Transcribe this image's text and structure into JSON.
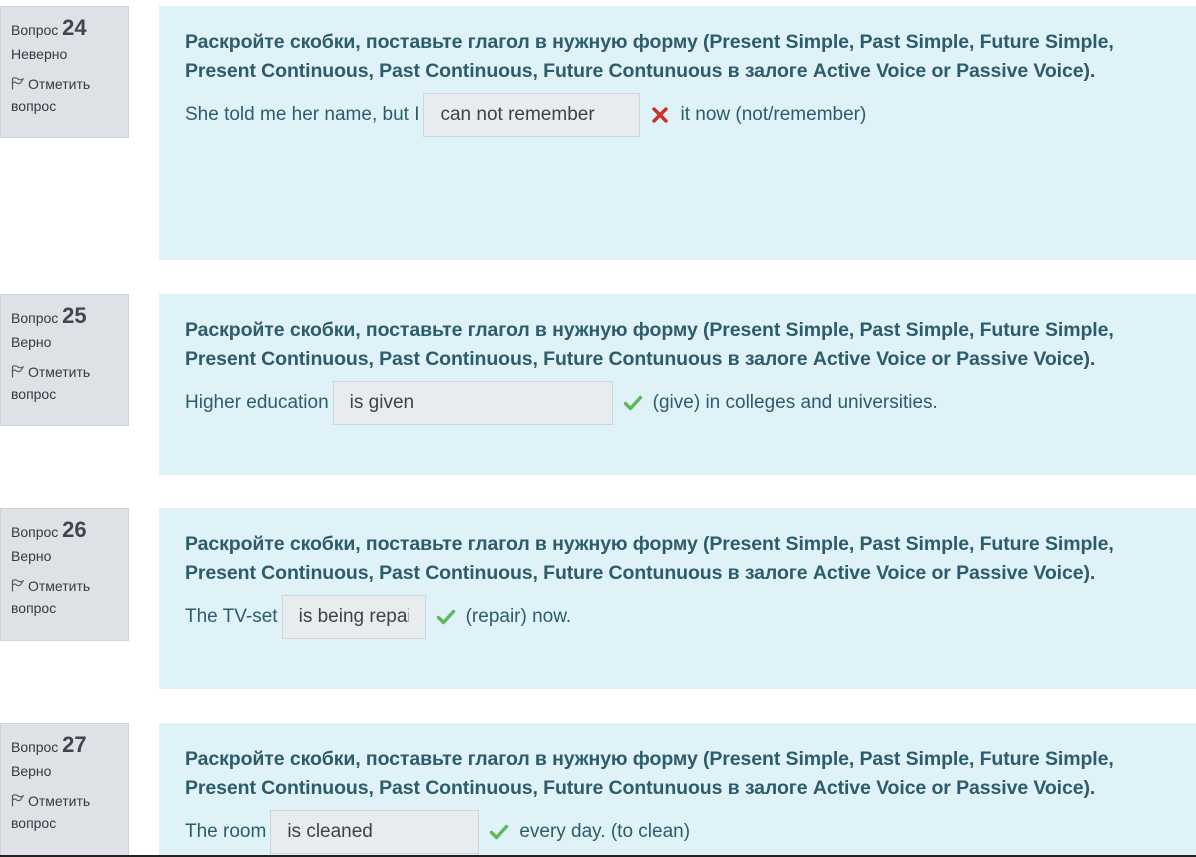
{
  "instruction": "Раскройте скобки, поставьте глагол в нужную форму (Present Simple, Past Simple, Future Simple, Present Continuous, Past Continuous, Future Contunuous в залоге Active Voice or Passive Voice).",
  "questions": [
    {
      "label": "Вопрос",
      "number": "24",
      "state": "Неверно",
      "flag": "Отметить вопрос",
      "before": "She told me her name, but I",
      "answer": "can not remember",
      "result": "incorrect",
      "after": "it now (not/remember)"
    },
    {
      "label": "Вопрос",
      "number": "25",
      "state": "Верно",
      "flag": "Отметить вопрос",
      "before": "Higher education",
      "answer": "is given",
      "result": "correct",
      "after": "(give)  in colleges and universities."
    },
    {
      "label": "Вопрос",
      "number": "26",
      "state": "Верно",
      "flag": "Отметить вопрос",
      "before": "The TV-set",
      "answer": "is being repaired",
      "result": "correct",
      "after": "(repair) now."
    },
    {
      "label": "Вопрос",
      "number": "27",
      "state": "Верно",
      "flag": "Отметить вопрос",
      "before": "The room",
      "answer": "is cleaned",
      "result": "correct",
      "after": "every day. (to clean)"
    }
  ],
  "icons": {
    "flag": "flag-icon",
    "incorrect": "cross-icon",
    "correct": "check-icon"
  },
  "colors": {
    "incorrect": "#ca3120",
    "correct": "#5cb85c",
    "content_bg": "#def2f8",
    "info_bg": "#dee2e6"
  }
}
